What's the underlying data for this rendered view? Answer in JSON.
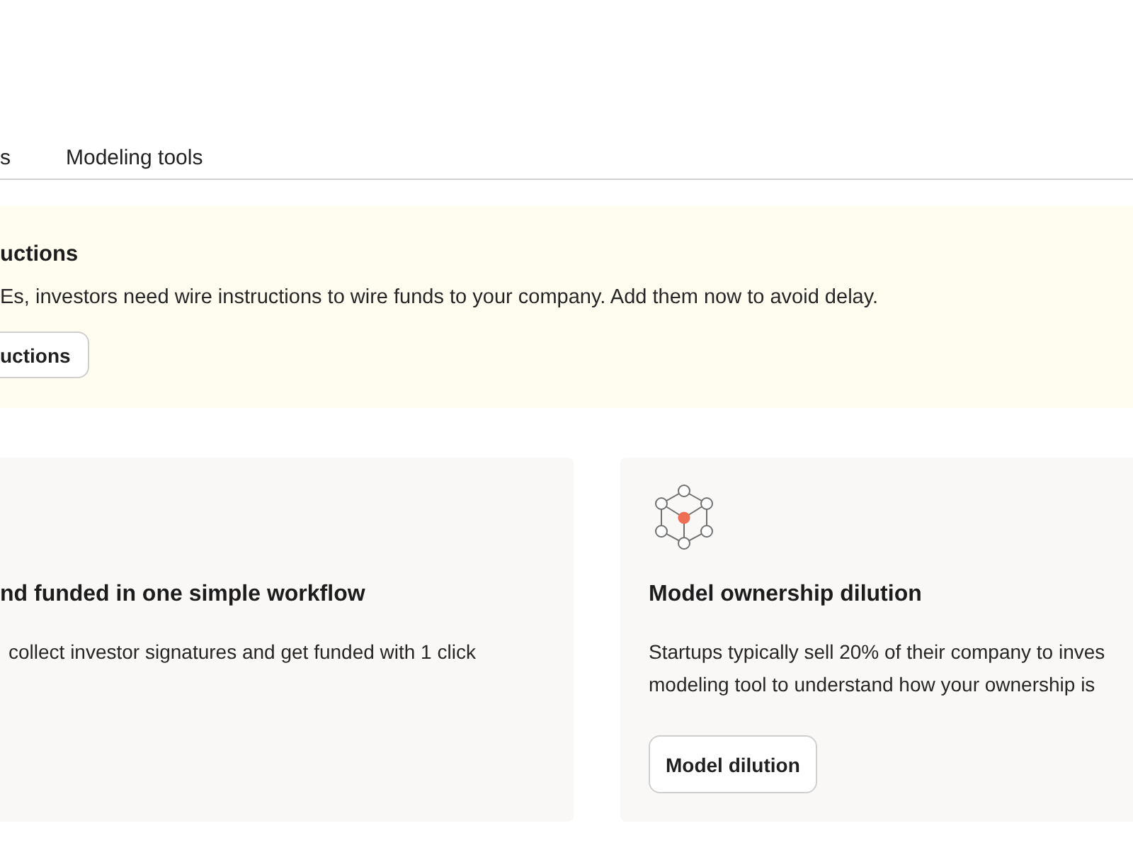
{
  "tabs": [
    {
      "label": "s",
      "selected": false
    },
    {
      "label": "Modeling tools",
      "selected": false
    }
  ],
  "banner": {
    "title": "uctions",
    "text": "Es, investors need wire instructions to wire funds to your company. Add them now to avoid delay.",
    "button": "uctions"
  },
  "cards": [
    {
      "title": "nd funded in one simple workflow",
      "lines": [
        "collect investor signatures and get funded with 1 click"
      ]
    },
    {
      "icon": true,
      "title": "Model ownership dilution",
      "lines": [
        "Startups typically sell 20% of their company to inves",
        "modeling tool to understand how your ownership is"
      ],
      "button": "Model dilution"
    }
  ]
}
